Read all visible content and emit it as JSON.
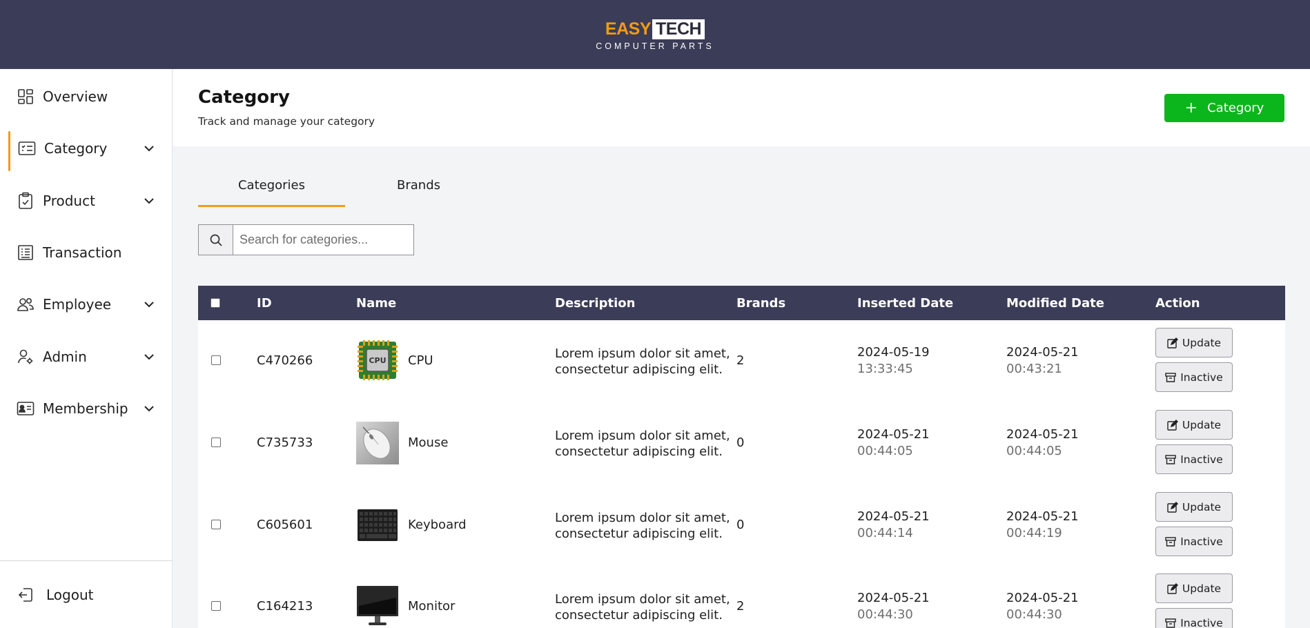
{
  "header": {
    "logo_easy": "EASY",
    "logo_tech": "TECH",
    "logo_sub": "COMPUTER PARTS",
    "bg_color": "#3b3c57"
  },
  "sidebar": {
    "items": [
      {
        "label": "Overview",
        "icon": "dashboard-icon",
        "has_chevron": false
      },
      {
        "label": "Category",
        "icon": "category-list-icon",
        "has_chevron": true,
        "active": true
      },
      {
        "label": "Product",
        "icon": "clipboard-check-icon",
        "has_chevron": true
      },
      {
        "label": "Transaction",
        "icon": "receipt-icon",
        "has_chevron": false
      },
      {
        "label": "Employee",
        "icon": "users-icon",
        "has_chevron": true
      },
      {
        "label": "Admin",
        "icon": "user-gear-icon",
        "has_chevron": true
      },
      {
        "label": "Membership",
        "icon": "id-card-icon",
        "has_chevron": true
      }
    ],
    "logout_label": "Logout",
    "active_accent": "#f59a16"
  },
  "page": {
    "title": "Category",
    "subtitle": "Track and manage your category",
    "add_button_label": "Category",
    "add_button_color": "#0bb51c"
  },
  "tabs": [
    {
      "label": "Categories",
      "active": true
    },
    {
      "label": "Brands",
      "active": false
    }
  ],
  "search": {
    "placeholder": "Search for categories..."
  },
  "table": {
    "columns": [
      "ID",
      "Name",
      "Description",
      "Brands",
      "Inserted Date",
      "Modified Date",
      "Action"
    ],
    "rows": [
      {
        "id": "C470266",
        "name": "CPU",
        "image": "cpu-image",
        "description_1": "Lorem ipsum dolor sit amet,",
        "description_2": "consectetur adipiscing elit.",
        "brands": "2",
        "inserted_date": "2024-05-19",
        "inserted_time": "13:33:45",
        "modified_date": "2024-05-21",
        "modified_time": "00:43:21",
        "update_label": "Update",
        "inactive_label": "Inactive"
      },
      {
        "id": "C735733",
        "name": "Mouse",
        "image": "mouse-image",
        "description_1": "Lorem ipsum dolor sit amet,",
        "description_2": "consectetur adipiscing elit.",
        "brands": "0",
        "inserted_date": "2024-05-21",
        "inserted_time": "00:44:05",
        "modified_date": "2024-05-21",
        "modified_time": "00:44:05",
        "update_label": "Update",
        "inactive_label": "Inactive"
      },
      {
        "id": "C605601",
        "name": "Keyboard",
        "image": "keyboard-image",
        "description_1": "Lorem ipsum dolor sit amet,",
        "description_2": "consectetur adipiscing elit.",
        "brands": "0",
        "inserted_date": "2024-05-21",
        "inserted_time": "00:44:14",
        "modified_date": "2024-05-21",
        "modified_time": "00:44:19",
        "update_label": "Update",
        "inactive_label": "Inactive"
      },
      {
        "id": "C164213",
        "name": "Monitor",
        "image": "monitor-image",
        "description_1": "Lorem ipsum dolor sit amet,",
        "description_2": "consectetur adipiscing elit.",
        "brands": "2",
        "inserted_date": "2024-05-21",
        "inserted_time": "00:44:30",
        "modified_date": "2024-05-21",
        "modified_time": "00:44:30",
        "update_label": "Update",
        "inactive_label": "Inactive"
      }
    ]
  }
}
